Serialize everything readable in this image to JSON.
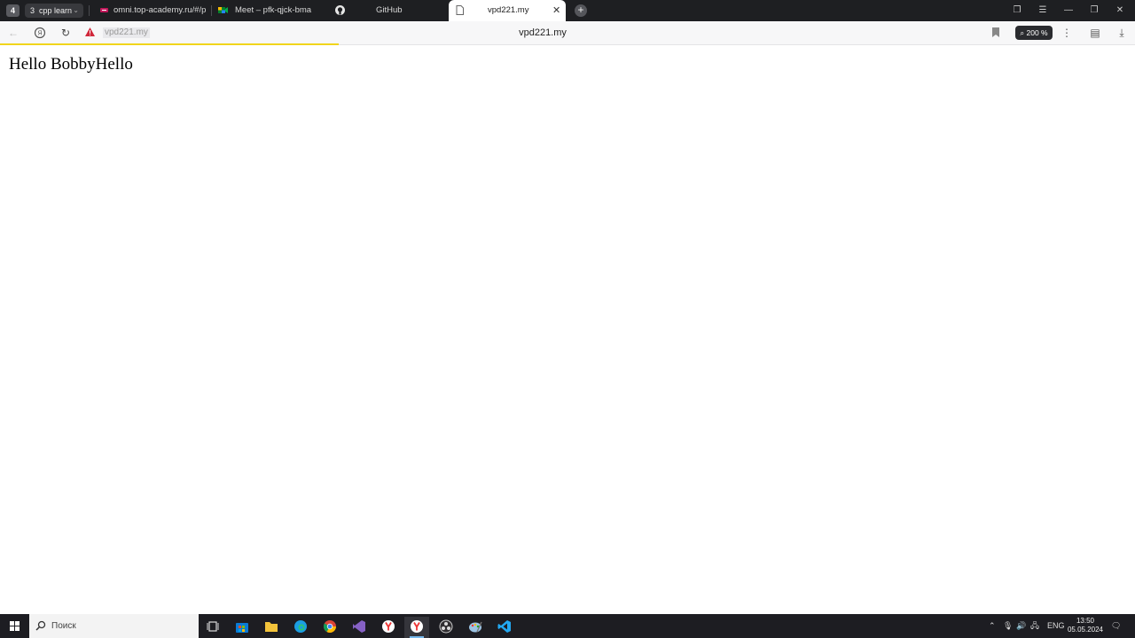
{
  "browser": {
    "group": {
      "count": "4",
      "tab_number": "3",
      "name": "cpp learn"
    },
    "tabs": [
      {
        "label": "omni.top-academy.ru/#/p",
        "active": false
      },
      {
        "label": "Meet – pfk-qjck-bma",
        "active": false
      },
      {
        "label": "GitHub",
        "active": false
      },
      {
        "label": "vpd221.my",
        "active": true
      }
    ],
    "address_bar": {
      "url_left": "vpd221.my",
      "title_center": "vpd221.my",
      "zoom": "200 %"
    },
    "colors": {
      "progress": "#f1d51c",
      "warning": "#d0273a"
    }
  },
  "page": {
    "heading": "Hello BobbyHello"
  },
  "taskbar": {
    "search_placeholder": "Поиск",
    "language": "ENG",
    "time": "13:50",
    "date": "05.05.2024"
  }
}
